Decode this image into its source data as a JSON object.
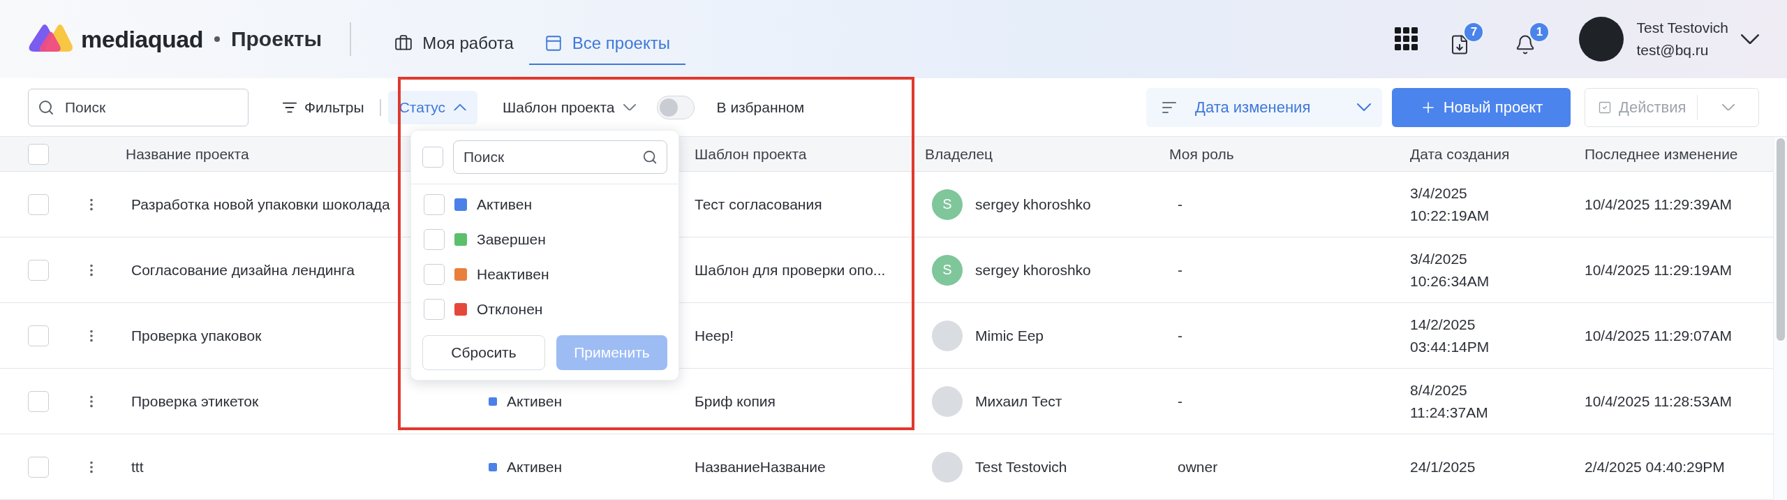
{
  "header": {
    "logo": "mediaquad",
    "section": "Проекты",
    "tabs": [
      {
        "label": "Моя работа",
        "selected": false
      },
      {
        "label": "Все проекты",
        "selected": true
      }
    ],
    "indicators": [
      {
        "kind": "download",
        "count": "7"
      },
      {
        "kind": "bell",
        "count": "1"
      }
    ],
    "user": {
      "name": "Test Testovich",
      "email": "test@bq.ru"
    }
  },
  "toolbar": {
    "search": {
      "placeholder": "Поиск"
    },
    "filters": "Фильтры",
    "status_filter": {
      "label": "Статус",
      "expanded": true
    },
    "template_filter": {
      "label": "Шаблон проекта",
      "expanded": false
    },
    "favorites": {
      "label": "В избранном",
      "on": false
    },
    "sort": {
      "label": "Дата изменения"
    },
    "new_project": "Новый проект",
    "actions": {
      "label": "Действия",
      "disabled": true
    }
  },
  "status_dropdown": {
    "search": {
      "placeholder": "Поиск"
    },
    "all_checked": false,
    "options": [
      {
        "label": "Активен",
        "color": "#4a80e8",
        "checked": false
      },
      {
        "label": "Завершен",
        "color": "#5cbf6a",
        "checked": false
      },
      {
        "label": "Неактивен",
        "color": "#e8803a",
        "checked": false
      },
      {
        "label": "Отклонен",
        "color": "#e5483b",
        "checked": false
      }
    ],
    "reset": "Сбросить",
    "apply": {
      "label": "Применить",
      "disabled": true
    }
  },
  "table": {
    "all_checked": false,
    "headers": {
      "name": "Название проекта",
      "template": "Шаблон проекта",
      "owner": "Владелец",
      "role": "Моя роль",
      "created": "Дата создания",
      "modified": "Последнее изменение"
    },
    "rows": [
      {
        "checked": false,
        "name": "Разработка новой упаковки шоколада",
        "template": "Тест согласования",
        "owner": {
          "name": "sergey khoroshko",
          "kind": "initial",
          "initial": "S"
        },
        "role": "-",
        "created_date": "3/4/2025",
        "created_time": "10:22:19AM",
        "modified": "10/4/2025 11:29:39AM"
      },
      {
        "checked": false,
        "name": "Согласование дизайна лендинга",
        "template": "Шаблон для проверки опо...",
        "owner": {
          "name": "sergey khoroshko",
          "kind": "initial",
          "initial": "S"
        },
        "role": "-",
        "created_date": "3/4/2025",
        "created_time": "10:26:34AM",
        "modified": "10/4/2025 11:29:19AM"
      },
      {
        "checked": false,
        "name": "Проверка упаковок",
        "template": "Heep!",
        "owner": {
          "name": "Mimic Eep",
          "kind": "photo"
        },
        "role": "-",
        "created_date": "14/2/2025",
        "created_time": "03:44:14PM",
        "modified": "10/4/2025 11:29:07AM"
      },
      {
        "checked": false,
        "name": "Проверка этикеток",
        "status": {
          "label": "Активен",
          "color": "#4a80e8"
        },
        "template": "Бриф копия",
        "owner": {
          "name": "Михаил Тест",
          "kind": "photo"
        },
        "role": "-",
        "created_date": "8/4/2025",
        "created_time": "11:24:37AM",
        "modified": "10/4/2025 11:28:53AM"
      },
      {
        "checked": false,
        "name": "ttt",
        "status": {
          "label": "Активен",
          "color": "#4a80e8"
        },
        "template": "НазваниеНазвание",
        "owner": {
          "name": "Test Testovich",
          "kind": "photo"
        },
        "role": "owner",
        "created_date": "24/1/2025",
        "modified": "2/4/2025 04:40:29PM"
      }
    ]
  }
}
